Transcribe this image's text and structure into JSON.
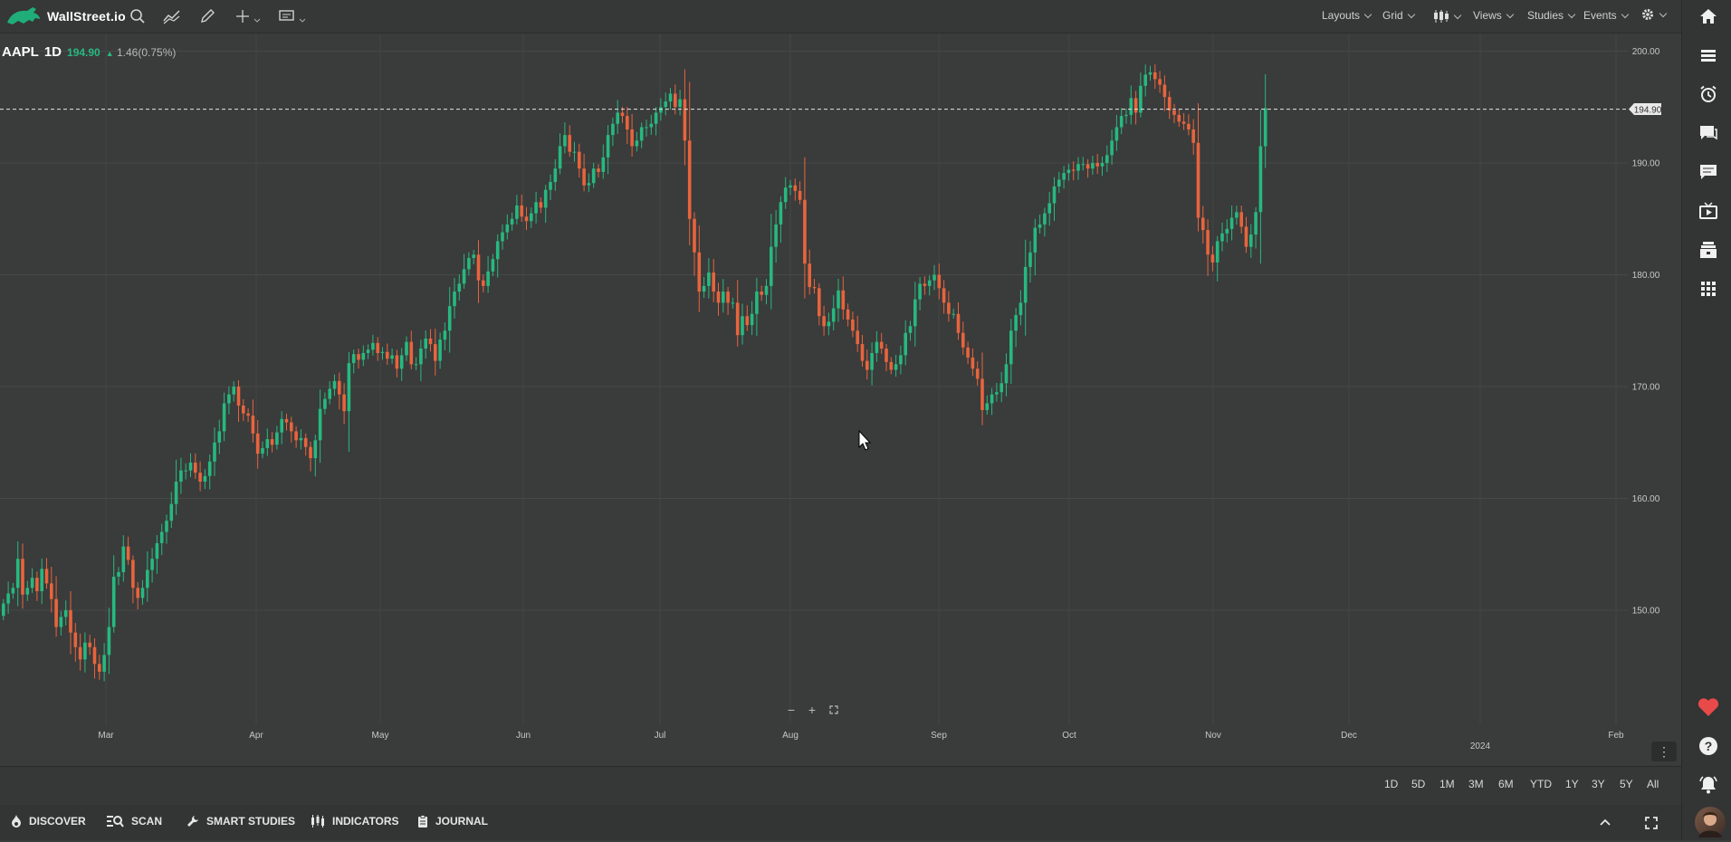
{
  "app": {
    "name": "WallStreet.io"
  },
  "toolbar": {
    "menus": [
      "Layouts",
      "Grid",
      "Views",
      "Studies",
      "Events"
    ]
  },
  "symbol": {
    "ticker": "AAPL",
    "timeframe": "1D",
    "price": "194.90",
    "change": "1.46(0.75%)",
    "price_tag": "194.90"
  },
  "chart_data": {
    "type": "candlestick",
    "y_ticks": [
      "200.00",
      "190.00",
      "180.00",
      "170.00",
      "160.00",
      "150.00"
    ],
    "x_ticks": [
      "Mar",
      "Apr",
      "May",
      "Jun",
      "Jul",
      "Aug",
      "Sep",
      "Oct",
      "Nov",
      "Dec",
      "2024",
      "Feb"
    ],
    "ylim": [
      140,
      200
    ],
    "last_price": 194.9,
    "up_color": "#26b980",
    "down_color": "#e8643c",
    "closes": [
      150.6,
      151.5,
      152.0,
      154.6,
      151.4,
      152.0,
      152.9,
      151.7,
      153.7,
      152.4,
      151.0,
      148.5,
      149.4,
      150.0,
      148.0,
      146.7,
      145.6,
      147.1,
      146.7,
      145.2,
      144.5,
      146.0,
      148.5,
      153.0,
      153.4,
      155.7,
      154.5,
      152.0,
      151.1,
      152.0,
      153.6,
      154.6,
      156.0,
      157.0,
      158.0,
      159.5,
      161.5,
      162.5,
      162.5,
      163.2,
      162.3,
      161.5,
      162.0,
      163.3,
      165.0,
      166.0,
      168.5,
      169.3,
      170.0,
      168.3,
      167.6,
      167.4,
      165.8,
      164.0,
      164.5,
      165.3,
      164.8,
      165.9,
      167.1,
      166.8,
      166.0,
      165.2,
      165.4,
      164.6,
      163.6,
      165.2,
      168.0,
      168.9,
      169.8,
      170.5,
      169.3,
      167.8,
      172.1,
      172.9,
      172.4,
      173.0,
      173.3,
      173.9,
      173.0,
      173.1,
      172.5,
      172.8,
      171.6,
      172.8,
      174.0,
      172.0,
      172.0,
      173.4,
      174.3,
      173.8,
      172.3,
      174.2,
      175.0,
      177.2,
      178.5,
      179.2,
      180.5,
      181.5,
      181.8,
      179.5,
      179.0,
      180.3,
      181.4,
      183.0,
      183.8,
      184.5,
      185.0,
      186.2,
      185.2,
      184.8,
      185.5,
      186.5,
      186.0,
      187.6,
      188.3,
      189.5,
      191.5,
      192.5,
      191.0,
      191.0,
      189.5,
      188.0,
      188.2,
      189.5,
      189.2,
      190.5,
      192.5,
      193.5,
      194.5,
      194.2,
      193.0,
      191.5,
      192.0,
      193.2,
      193.2,
      193.5,
      194.5,
      195.0,
      195.5,
      196.2,
      195.0,
      195.7,
      192.0,
      185.0,
      182.0,
      178.5,
      179.0,
      180.2,
      178.5,
      177.5,
      178.5,
      177.5,
      177.5,
      174.6,
      176.3,
      175.5,
      176.5,
      178.5,
      178.2,
      179.0,
      182.5,
      184.5,
      186.5,
      187.8,
      188.0,
      187.5,
      186.7,
      181.0,
      178.9,
      178.8,
      176.3,
      175.4,
      175.8,
      177.0,
      178.6,
      176.9,
      176.0,
      175.0,
      173.8,
      172.3,
      171.5,
      173.0,
      174.0,
      173.4,
      172.2,
      171.5,
      172.0,
      172.8,
      174.8,
      175.4,
      177.8,
      179.2,
      179.0,
      179.5,
      180.0,
      178.8,
      177.5,
      176.5,
      176.5,
      174.8,
      173.5,
      172.6,
      171.6,
      170.7,
      167.9,
      168.5,
      169.3,
      169.5,
      170.3,
      172.0,
      175.0,
      176.4,
      177.5,
      180.7,
      182.0,
      184.2,
      184.5,
      185.5,
      186.4,
      187.9,
      188.5,
      189.1,
      189.4,
      189.3,
      189.9,
      189.9,
      189.5,
      190.0,
      189.7,
      190.0,
      190.7,
      192.0,
      193.2,
      194.2,
      194.3,
      195.8,
      194.5,
      196.9,
      197.9,
      198.1,
      197.5,
      197.0,
      195.9,
      194.7,
      194.3,
      193.7,
      193.5,
      193.0,
      191.8,
      185.1,
      184.0,
      181.8,
      181.1,
      183.0,
      183.7,
      184.1,
      185.1,
      185.6,
      184.3,
      182.5,
      183.6,
      185.6,
      191.5,
      194.9
    ],
    "opens": [
      149.5,
      150.6,
      151.5,
      152.0,
      154.6,
      151.4,
      152.0,
      152.9,
      151.7,
      153.7,
      152.4,
      151.0,
      148.5,
      149.4,
      150.0,
      148.0,
      146.7,
      145.6,
      147.1,
      146.7,
      145.2,
      144.5,
      146.0,
      148.5,
      153.0,
      153.4,
      155.7,
      154.5,
      152.0,
      151.1,
      152.0,
      153.6,
      154.6,
      156.0,
      157.0,
      158.0,
      159.5,
      161.5,
      162.5,
      162.5,
      163.2,
      162.3,
      161.5,
      162.0,
      163.3,
      165.0,
      166.0,
      168.5,
      169.3,
      170.0,
      168.3,
      167.6,
      167.4,
      165.8,
      164.0,
      164.5,
      165.3,
      164.8,
      165.9,
      167.1,
      166.8,
      166.0,
      165.2,
      165.4,
      164.6,
      163.6,
      165.2,
      168.0,
      168.9,
      169.8,
      170.5,
      169.3,
      167.8,
      172.1,
      172.9,
      172.4,
      173.0,
      173.3,
      173.9,
      173.0,
      173.1,
      172.5,
      172.8,
      171.6,
      172.8,
      174.0,
      172.0,
      172.0,
      173.4,
      174.3,
      173.8,
      172.3,
      174.2,
      175.0,
      177.2,
      178.5,
      179.2,
      180.5,
      181.5,
      181.8,
      179.5,
      179.0,
      180.3,
      181.4,
      183.0,
      183.8,
      184.5,
      185.0,
      186.2,
      185.2,
      184.8,
      185.5,
      186.5,
      186.0,
      187.6,
      188.3,
      189.5,
      191.5,
      192.5,
      191.0,
      191.0,
      189.5,
      188.0,
      188.2,
      189.5,
      189.2,
      190.5,
      192.5,
      193.5,
      194.5,
      194.2,
      193.0,
      191.5,
      192.0,
      193.2,
      193.2,
      193.5,
      194.5,
      195.0,
      195.5,
      196.2,
      195.0,
      195.7,
      192.0,
      185.0,
      182.0,
      178.5,
      179.0,
      180.2,
      178.5,
      177.5,
      178.5,
      177.5,
      177.5,
      174.6,
      176.3,
      175.5,
      176.5,
      178.5,
      178.2,
      179.0,
      182.5,
      184.5,
      186.5,
      187.8,
      188.0,
      187.5,
      186.7,
      181.0,
      178.9,
      178.8,
      176.3,
      175.4,
      175.8,
      177.0,
      178.6,
      176.9,
      176.0,
      175.0,
      173.8,
      172.3,
      171.5,
      173.0,
      174.0,
      173.4,
      172.2,
      171.5,
      172.0,
      172.8,
      174.8,
      175.4,
      177.8,
      179.2,
      179.0,
      179.5,
      180.0,
      178.8,
      177.5,
      176.5,
      176.5,
      174.8,
      173.5,
      172.6,
      171.6,
      170.7,
      167.9,
      168.5,
      169.3,
      169.5,
      170.3,
      172.0,
      175.0,
      176.4,
      177.5,
      180.7,
      182.0,
      184.2,
      184.5,
      185.5,
      186.4,
      187.9,
      188.5,
      189.1,
      189.4,
      189.3,
      189.9,
      189.9,
      189.5,
      190.0,
      189.7,
      190.0,
      190.7,
      192.0,
      193.2,
      194.2,
      194.3,
      195.8,
      194.5,
      196.9,
      197.9,
      198.1,
      197.5,
      197.0,
      195.9,
      194.7,
      194.3,
      193.7,
      193.5,
      193.0,
      191.8,
      185.1,
      184.0,
      181.8,
      181.1,
      183.0,
      183.7,
      184.1,
      185.1,
      185.6,
      184.3,
      182.5,
      183.6,
      185.6,
      191.5
    ]
  },
  "range_buttons": [
    "1D",
    "5D",
    "1M",
    "3M",
    "6M",
    "YTD",
    "1Y",
    "3Y",
    "5Y",
    "All"
  ],
  "bottom_nav": [
    "DISCOVER",
    "SCAN",
    "SMART STUDIES",
    "INDICATORS",
    "JOURNAL"
  ]
}
